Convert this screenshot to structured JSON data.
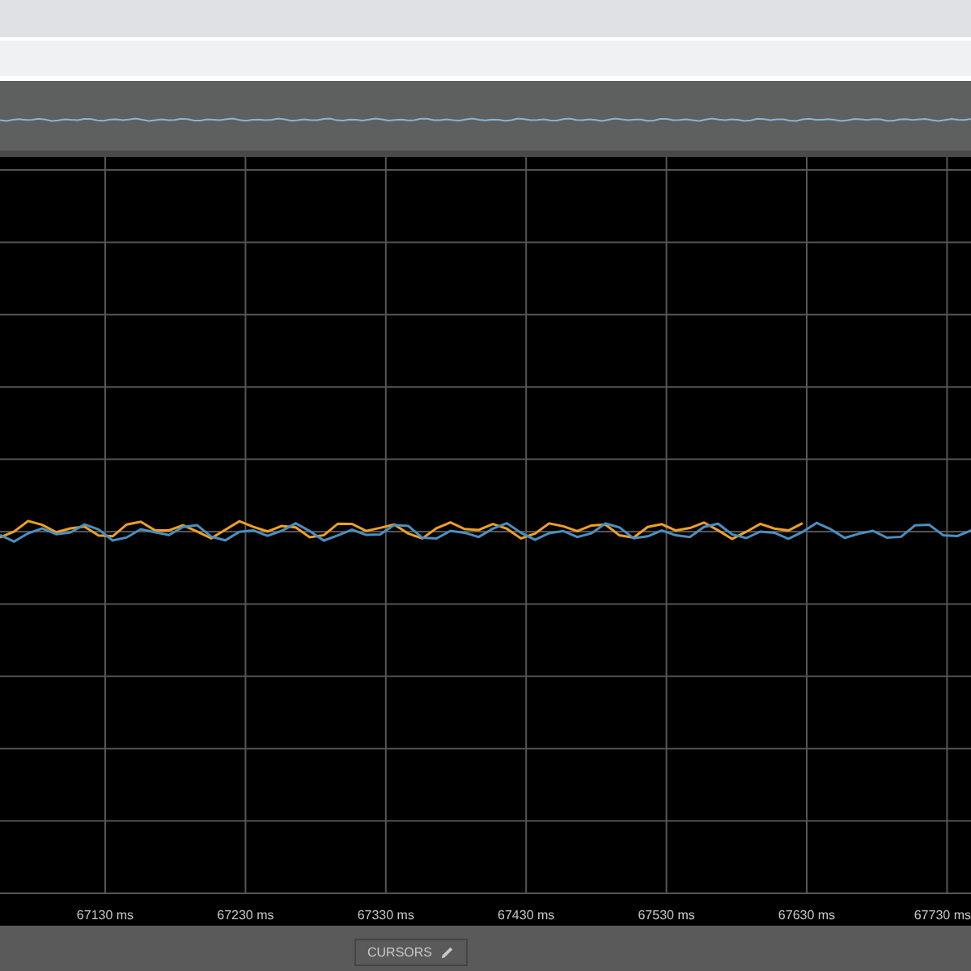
{
  "plot": {
    "x_labels": [
      "67130 ms",
      "67230 ms",
      "67330 ms",
      "67430 ms",
      "67530 ms",
      "67630 ms",
      "67730 ms"
    ]
  },
  "cursors_button": {
    "label": "CURSORS"
  }
}
